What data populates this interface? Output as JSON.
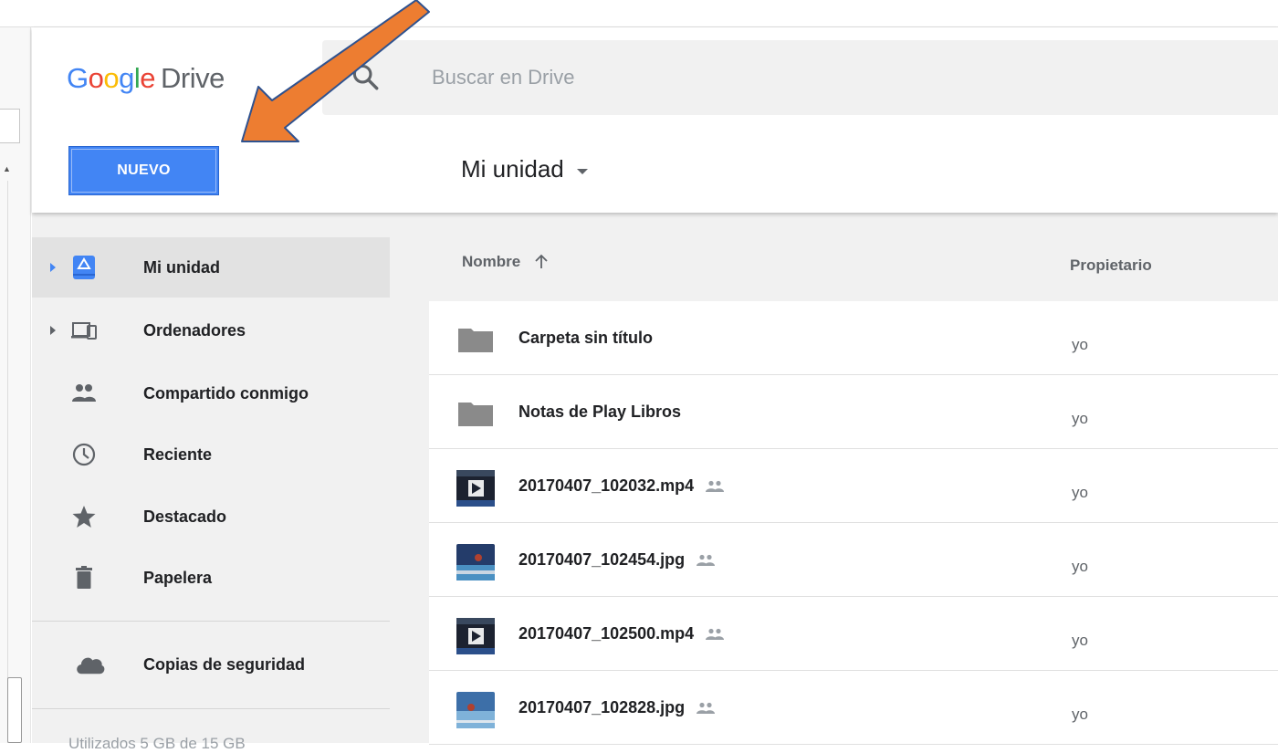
{
  "header": {
    "logo": {
      "g1": "G",
      "o1": "o",
      "o2": "o",
      "g2": "g",
      "l": "l",
      "e": "e",
      "drive": "Drive"
    },
    "search_placeholder": "Buscar en Drive",
    "new_button": "NUEVO",
    "title": "Mi unidad"
  },
  "sidebar": {
    "items": [
      {
        "label": "Mi unidad",
        "icon": "drive-icon",
        "active": true
      },
      {
        "label": "Ordenadores",
        "icon": "computers-icon"
      },
      {
        "label": "Compartido conmigo",
        "icon": "shared-people-icon"
      },
      {
        "label": "Reciente",
        "icon": "clock-icon"
      },
      {
        "label": "Destacado",
        "icon": "star-icon"
      },
      {
        "label": "Papelera",
        "icon": "trash-icon"
      },
      {
        "label": "Copias de seguridad",
        "icon": "cloud-icon"
      }
    ],
    "storage": "Utilizados 5 GB de 15 GB"
  },
  "list": {
    "col_name": "Nombre",
    "col_owner": "Propietario",
    "rows": [
      {
        "name": "Carpeta sin título",
        "owner": "yo",
        "type": "folder",
        "shared": false
      },
      {
        "name": "Notas de Play Libros",
        "owner": "yo",
        "type": "folder",
        "shared": false
      },
      {
        "name": "20170407_102032.mp4",
        "owner": "yo",
        "type": "video",
        "shared": true
      },
      {
        "name": "20170407_102454.jpg",
        "owner": "yo",
        "type": "image",
        "shared": true
      },
      {
        "name": "20170407_102500.mp4",
        "owner": "yo",
        "type": "video",
        "shared": true
      },
      {
        "name": "20170407_102828.jpg",
        "owner": "yo",
        "type": "image",
        "shared": true
      }
    ]
  },
  "colors": {
    "brand_blue": "#4285f4",
    "annotation_arrow": "#ed7d31"
  }
}
